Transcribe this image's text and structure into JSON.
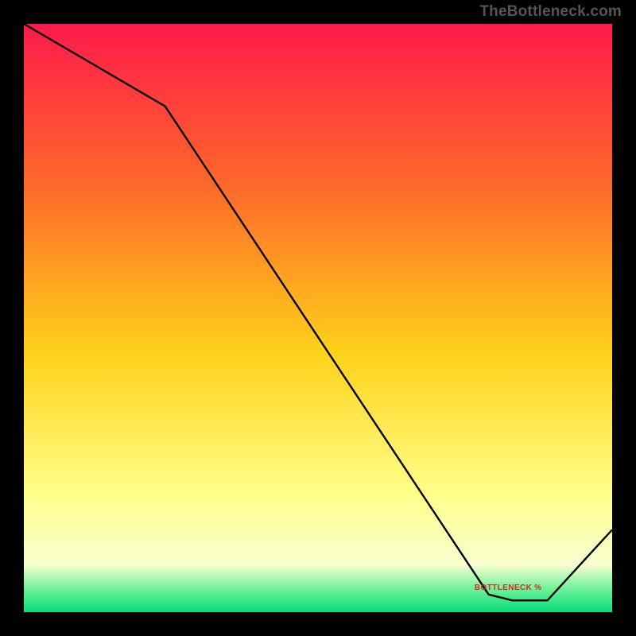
{
  "watermark": "TheBottleneck.com",
  "annotation": "BOTTLENECK %",
  "colors": {
    "grad_top": "#ff1a4c",
    "grad_upper": "#ff6a2a",
    "grad_mid": "#ffd21a",
    "grad_low": "#ffff8a",
    "grad_pale": "#f7ffd0",
    "grad_band": "#6ef29a",
    "grad_bottom": "#08dd7a",
    "line": "#000000"
  },
  "chart_data": {
    "type": "line",
    "title": "",
    "xlabel": "",
    "ylabel": "",
    "xlim": [
      0,
      100
    ],
    "ylim": [
      0,
      100
    ],
    "x": [
      0,
      24,
      79,
      83,
      89,
      100
    ],
    "values": [
      100,
      86,
      3,
      2,
      2,
      14
    ],
    "annotation": {
      "text": "BOTTLENECK %",
      "x": 82,
      "y": 4
    }
  }
}
